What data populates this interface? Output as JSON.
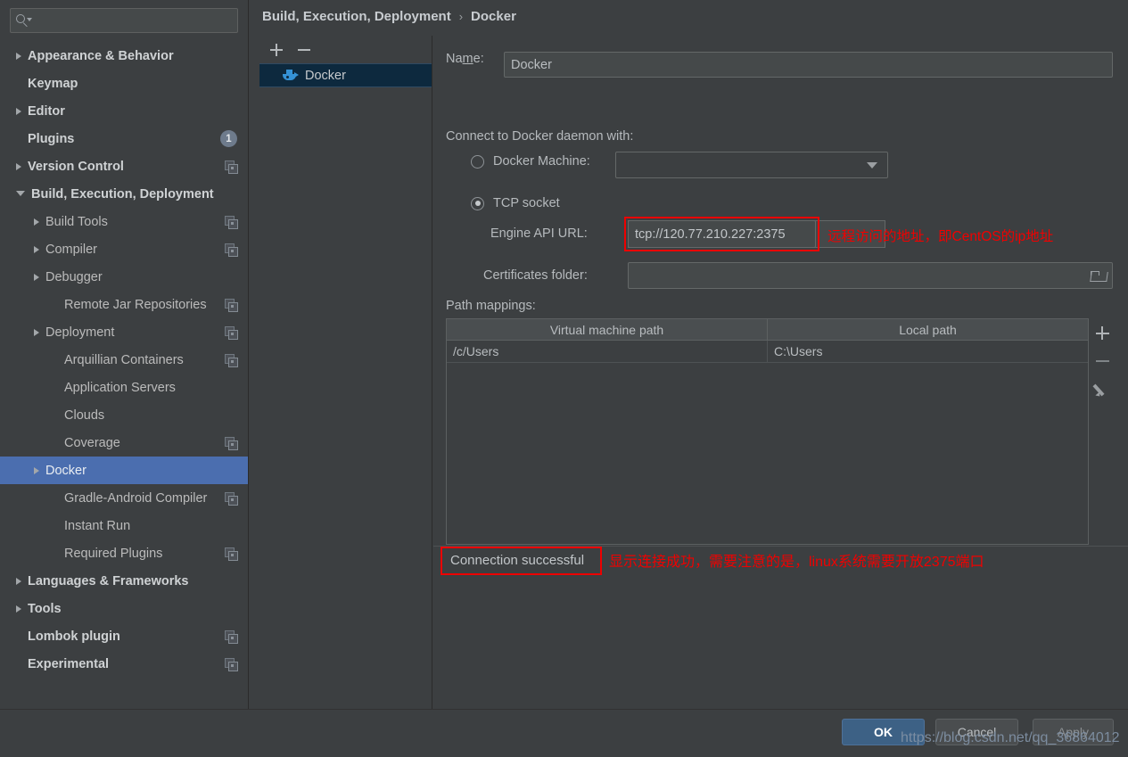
{
  "sidebar": {
    "search": {
      "placeholder": "",
      "value": "",
      "icon": "search-icon"
    },
    "items": [
      {
        "label": "Appearance & Behavior",
        "arrow": "right",
        "bold": true,
        "indent": "lv0",
        "badge": null,
        "copy": false,
        "selected": false
      },
      {
        "label": "Keymap",
        "arrow": "none",
        "bold": true,
        "indent": "lv0",
        "badge": null,
        "copy": false,
        "selected": false
      },
      {
        "label": "Editor",
        "arrow": "right",
        "bold": true,
        "indent": "lv0",
        "badge": null,
        "copy": false,
        "selected": false
      },
      {
        "label": "Plugins",
        "arrow": "none",
        "bold": true,
        "indent": "lv0",
        "badge": "1",
        "copy": false,
        "selected": false
      },
      {
        "label": "Version Control",
        "arrow": "right",
        "bold": true,
        "indent": "lv0",
        "badge": null,
        "copy": true,
        "selected": false
      },
      {
        "label": "Build, Execution, Deployment",
        "arrow": "down",
        "bold": true,
        "indent": "lv0",
        "badge": null,
        "copy": false,
        "selected": false
      },
      {
        "label": "Build Tools",
        "arrow": "right",
        "bold": false,
        "indent": "lv1",
        "badge": null,
        "copy": true,
        "selected": false
      },
      {
        "label": "Compiler",
        "arrow": "right",
        "bold": false,
        "indent": "lv1",
        "badge": null,
        "copy": true,
        "selected": false
      },
      {
        "label": "Debugger",
        "arrow": "right",
        "bold": false,
        "indent": "lv1",
        "badge": null,
        "copy": false,
        "selected": false
      },
      {
        "label": "Remote Jar Repositories",
        "arrow": "none",
        "bold": false,
        "indent": "lv1b",
        "badge": null,
        "copy": true,
        "selected": false
      },
      {
        "label": "Deployment",
        "arrow": "right",
        "bold": false,
        "indent": "lv1",
        "badge": null,
        "copy": true,
        "selected": false
      },
      {
        "label": "Arquillian Containers",
        "arrow": "none",
        "bold": false,
        "indent": "lv1b",
        "badge": null,
        "copy": true,
        "selected": false
      },
      {
        "label": "Application Servers",
        "arrow": "none",
        "bold": false,
        "indent": "lv1b",
        "badge": null,
        "copy": false,
        "selected": false
      },
      {
        "label": "Clouds",
        "arrow": "none",
        "bold": false,
        "indent": "lv1b",
        "badge": null,
        "copy": false,
        "selected": false
      },
      {
        "label": "Coverage",
        "arrow": "none",
        "bold": false,
        "indent": "lv1b",
        "badge": null,
        "copy": true,
        "selected": false
      },
      {
        "label": "Docker",
        "arrow": "right",
        "bold": false,
        "indent": "lv1",
        "badge": null,
        "copy": false,
        "selected": true
      },
      {
        "label": "Gradle-Android Compiler",
        "arrow": "none",
        "bold": false,
        "indent": "lv1b",
        "badge": null,
        "copy": true,
        "selected": false
      },
      {
        "label": "Instant Run",
        "arrow": "none",
        "bold": false,
        "indent": "lv1b",
        "badge": null,
        "copy": false,
        "selected": false
      },
      {
        "label": "Required Plugins",
        "arrow": "none",
        "bold": false,
        "indent": "lv1b",
        "badge": null,
        "copy": true,
        "selected": false
      },
      {
        "label": "Languages & Frameworks",
        "arrow": "right",
        "bold": true,
        "indent": "lv0",
        "badge": null,
        "copy": false,
        "selected": false
      },
      {
        "label": "Tools",
        "arrow": "right",
        "bold": true,
        "indent": "lv0",
        "badge": null,
        "copy": false,
        "selected": false
      },
      {
        "label": "Lombok plugin",
        "arrow": "none",
        "bold": true,
        "indent": "lv0",
        "badge": null,
        "copy": true,
        "selected": false
      },
      {
        "label": "Experimental",
        "arrow": "none",
        "bold": true,
        "indent": "lv0",
        "badge": null,
        "copy": true,
        "selected": false
      }
    ]
  },
  "help": {
    "label": "?"
  },
  "breadcrumb": {
    "root": "Build, Execution, Deployment",
    "separator": "›",
    "leaf": "Docker"
  },
  "config_panel": {
    "add_label": "+",
    "remove_label": "−",
    "items": [
      {
        "label": "Docker",
        "icon": "docker-whale-icon",
        "selected": true
      }
    ]
  },
  "main": {
    "name_label_pre": "Na",
    "name_label_mnemonic": "m",
    "name_label_post": "e:",
    "name_value": "Docker",
    "connect_label": "Connect to Docker daemon with:",
    "docker_machine_label": "Docker Machine:",
    "docker_machine_value": "",
    "docker_machine_selected": false,
    "tcp_socket_label": "TCP socket",
    "tcp_socket_selected": true,
    "api_url_label": "Engine API URL:",
    "api_url_value": "tcp://120.77.210.227:2375",
    "api_url_note": "远程访问的地址，即CentOS的ip地址",
    "cert_label": "Certificates folder:",
    "cert_value": "",
    "path_mappings_label": "Path mappings:",
    "table": {
      "columns": [
        "Virtual machine path",
        "Local path"
      ],
      "rows": [
        [
          "/c/Users",
          "C:\\Users"
        ]
      ],
      "actions": [
        "add-row-icon",
        "remove-row-icon",
        "edit-row-icon"
      ]
    },
    "connection_status": "Connection successful",
    "connection_note": "显示连接成功，需要注意的是，linux系统需要开放2375端口"
  },
  "footer": {
    "ok_label": "OK",
    "cancel_label": "Cancel",
    "apply_label": "Apply",
    "watermark": "https://blog.csdn.net/qq_36864012"
  },
  "colors": {
    "background": "#3c3f41",
    "selection": "#4b6eaf",
    "config_selection": "#0d293e",
    "annotation_red": "#f00000",
    "accent_blue": "#3592d6",
    "ok_button": "#3d6185",
    "text": "#bbbbbb"
  }
}
